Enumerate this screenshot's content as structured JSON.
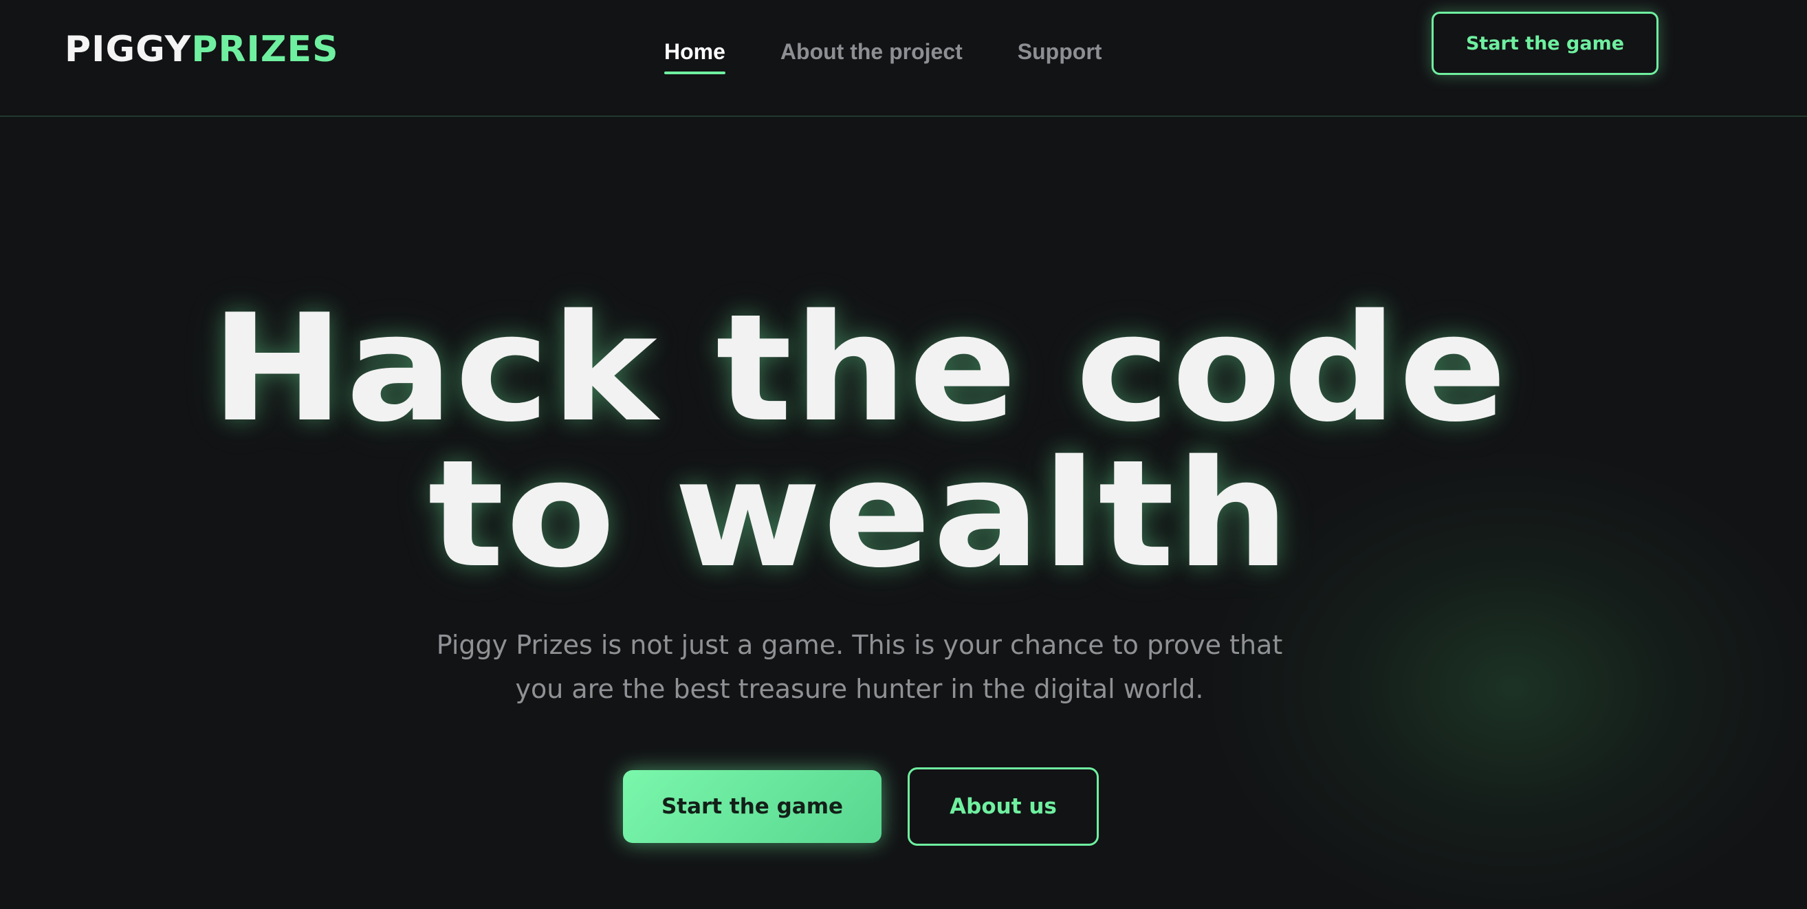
{
  "logo": {
    "part1": "PIGGY",
    "part2": "PRIZES"
  },
  "nav": {
    "items": [
      {
        "label": "Home",
        "active": true
      },
      {
        "label": "About the project",
        "active": false
      },
      {
        "label": "Support",
        "active": false
      }
    ]
  },
  "header": {
    "cta_label": "Start the game"
  },
  "hero": {
    "title_lines": [
      "Hack the code",
      "to wealth"
    ],
    "subtitle_lines": [
      "Piggy Prizes is not just a game. This is your chance to prove that",
      "you are the best treasure hunter in the digital world."
    ],
    "primary_button": "Start the game",
    "secondary_button": "About us"
  },
  "colors": {
    "background": "#121315",
    "accent": "#6ff0a0",
    "text_primary": "#f2f2f2",
    "text_muted": "#8f9194"
  }
}
